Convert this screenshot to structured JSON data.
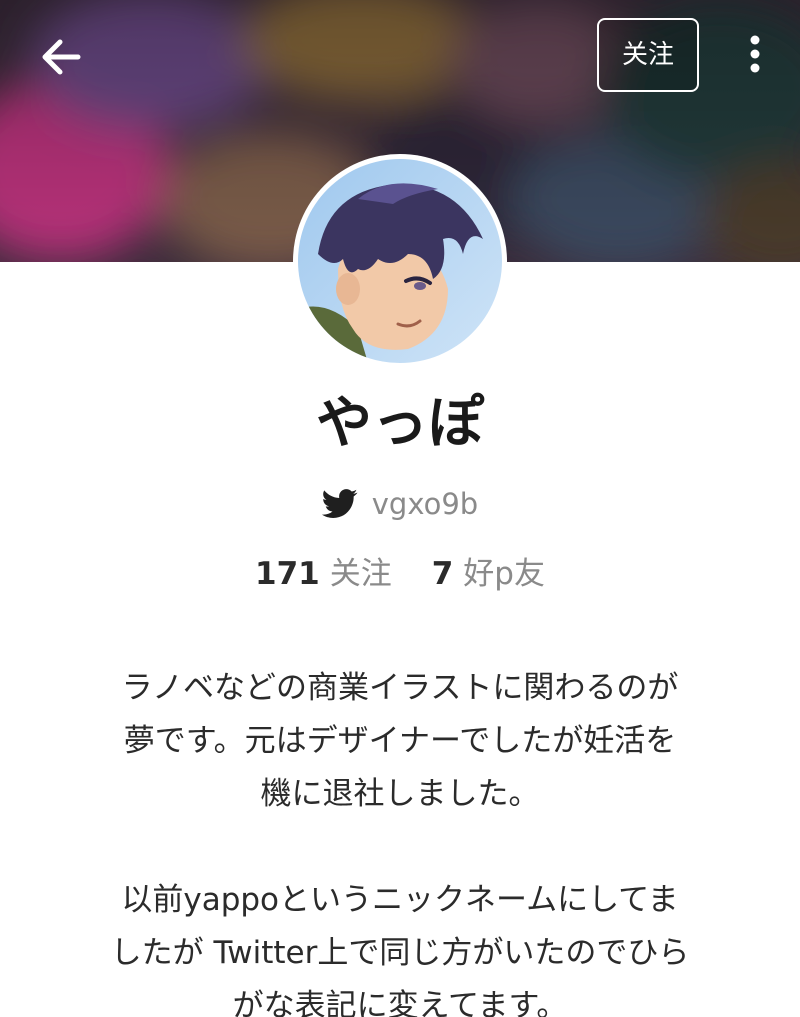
{
  "header": {
    "back_icon": "arrow-left-icon",
    "follow_label": "关注",
    "more_icon": "more-vertical-icon"
  },
  "profile": {
    "display_name": "やっぽ",
    "twitter_icon": "twitter-bird-icon",
    "twitter_handle": "vgxo9b",
    "following_count": "171",
    "following_label": "关注",
    "friends_count": "7",
    "friends_label": "好p友"
  },
  "bio": {
    "lines": [
      "ラノベなどの商業イラストに関わるのが",
      "夢です。元はデザイナーでしたが妊活を",
      "機に退社しました。",
      "以前yappoというニックネームにしてま",
      "したが Twitter上で同じ方がいたのでひら",
      "がな表記に変えてます。"
    ]
  },
  "colors": {
    "text_primary": "#1a1a1a",
    "text_secondary": "#8a8a8a",
    "header_icon": "#ffffff"
  }
}
